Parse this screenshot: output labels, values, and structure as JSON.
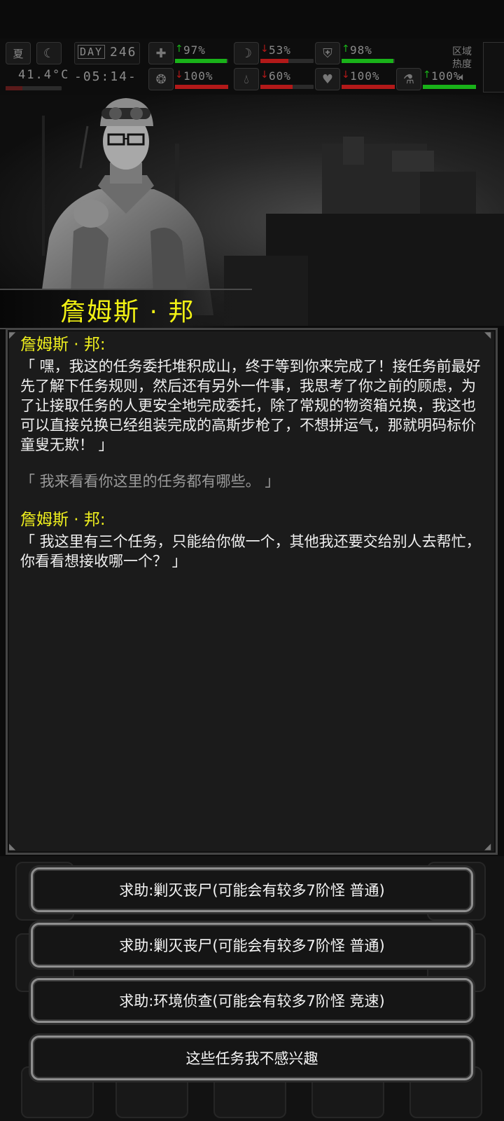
{
  "status": {
    "season": "夏",
    "temperature": "41.4°C",
    "day_label": "DAY",
    "day_number": "246",
    "clock": "-05:14-",
    "region_label": "区域热度",
    "metrics": [
      {
        "icon": "medkit-icon",
        "value": "97%",
        "trend": "up",
        "level": 0.97,
        "color": "#19b219"
      },
      {
        "icon": "stomach-icon",
        "value": "53%",
        "trend": "down",
        "level": 0.53,
        "color": "#b21919"
      },
      {
        "icon": "armor-icon",
        "value": "98%",
        "trend": "up",
        "level": 0.98,
        "color": "#19b219"
      },
      {
        "icon": "brain-icon",
        "value": "100%",
        "trend": "down",
        "level": 1.0,
        "color": "#b21919"
      },
      {
        "icon": "water-drop-icon",
        "value": "60%",
        "trend": "down",
        "level": 0.6,
        "color": "#b21919"
      },
      {
        "icon": "heart-icon",
        "value": "100%",
        "trend": "down",
        "level": 1.0,
        "color": "#b21919"
      },
      {
        "icon": "flask-icon",
        "value": "100%",
        "trend": "up",
        "level": 1.0,
        "color": "#19b219"
      }
    ]
  },
  "npc": {
    "name": "詹姆斯 · 邦"
  },
  "dialog": {
    "speaker_1": "詹姆斯 · 邦:",
    "line_1": "「 嘿，我这的任务委托堆积成山，终于等到你来完成了！接任务前最好先了解下任务规则，然后还有另外一件事，我思考了你之前的顾虑，为了让接取任务的人更安全地完成委托，除了常规的物资箱兑换，我这也可以直接兑换已经组装完成的高斯步枪了，不想拼运气，那就明码标价童叟无欺！ 」",
    "player_line": "「 我来看看你这里的任务都有哪些。 」",
    "speaker_2": "詹姆斯 · 邦:",
    "line_2": "「 我这里有三个任务，只能给你做一个，其他我还要交给别人去帮忙，你看看想接收哪一个？ 」"
  },
  "choices": [
    "求助:剿灭丧尸(可能会有较多7阶怪  普通)",
    "求助:剿灭丧尸(可能会有较多7阶怪  普通)",
    "求助:环境侦查(可能会有较多7阶怪  竞速)",
    "这些任务我不感兴趣"
  ]
}
